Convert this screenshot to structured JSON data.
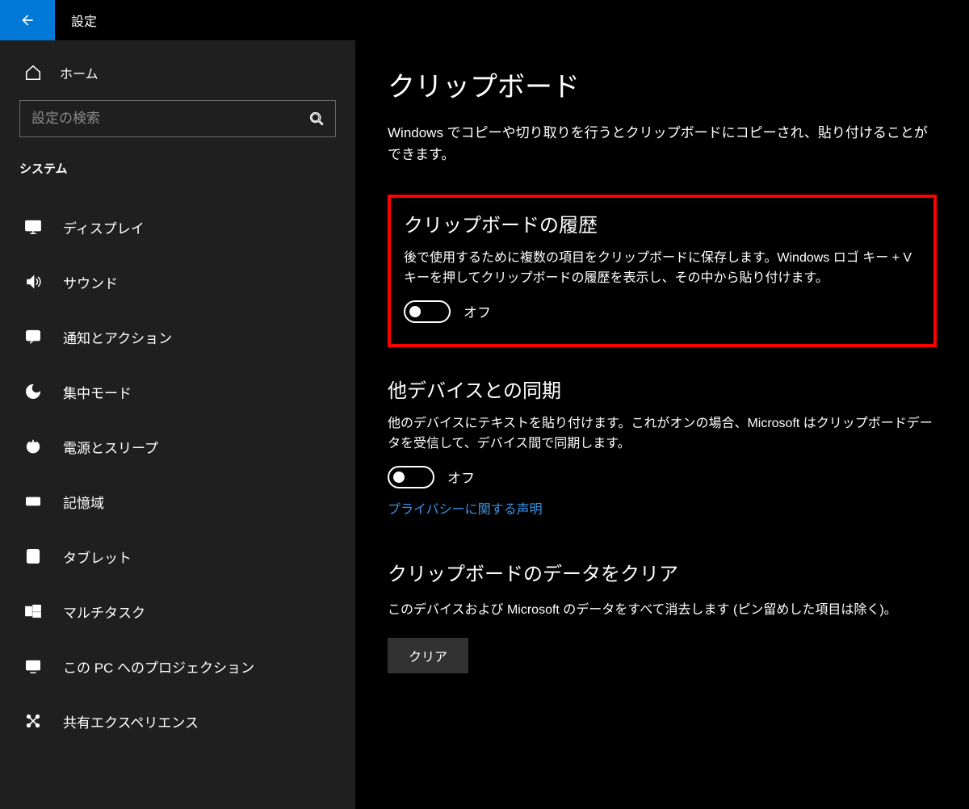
{
  "titlebar": {
    "title": "設定"
  },
  "sidebar": {
    "home_label": "ホーム",
    "search_placeholder": "設定の検索",
    "section_label": "システム",
    "items": [
      {
        "label": "ディスプレイ",
        "icon": "display"
      },
      {
        "label": "サウンド",
        "icon": "sound"
      },
      {
        "label": "通知とアクション",
        "icon": "notifications"
      },
      {
        "label": "集中モード",
        "icon": "focus"
      },
      {
        "label": "電源とスリープ",
        "icon": "power"
      },
      {
        "label": "記憶域",
        "icon": "storage"
      },
      {
        "label": "タブレット",
        "icon": "tablet"
      },
      {
        "label": "マルチタスク",
        "icon": "multitask"
      },
      {
        "label": "この PC へのプロジェクション",
        "icon": "projection"
      },
      {
        "label": "共有エクスペリエンス",
        "icon": "share"
      }
    ]
  },
  "main": {
    "title": "クリップボード",
    "intro": "Windows でコピーや切り取りを行うとクリップボードにコピーされ、貼り付けることができます。",
    "history": {
      "heading": "クリップボードの履歴",
      "desc": "後で使用するために複数の項目をクリップボードに保存します。Windows ロゴ キー + V キーを押してクリップボードの履歴を表示し、その中から貼り付けます。",
      "toggle_label": "オフ"
    },
    "sync": {
      "heading": "他デバイスとの同期",
      "desc": "他のデバイスにテキストを貼り付けます。これがオンの場合、Microsoft はクリップボードデータを受信して、デバイス間で同期します。",
      "toggle_label": "オフ",
      "privacy_link": "プライバシーに関する声明"
    },
    "clear": {
      "heading": "クリップボードのデータをクリア",
      "desc": "このデバイスおよび Microsoft のデータをすべて消去します (ピン留めした項目は除く)。",
      "button": "クリア"
    }
  }
}
